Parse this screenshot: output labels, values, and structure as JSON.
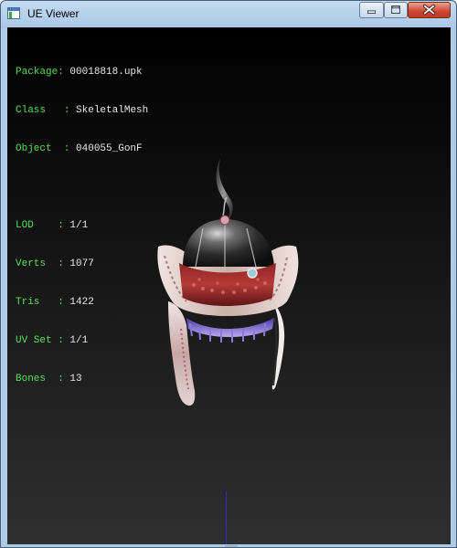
{
  "window": {
    "title": "UE Viewer",
    "colors": {
      "frame": "#aecbe6",
      "close_button": "#c9462f",
      "label_text": "#55e055",
      "value_text": "#e8e8e8",
      "axis_line": "#2a2ad8"
    }
  },
  "controls": {
    "minimize_icon": "minimize-icon",
    "maximize_icon": "maximize-icon",
    "close_icon": "close-icon"
  },
  "info": {
    "package": {
      "label": "Package",
      "value": "00018818.upk"
    },
    "class": {
      "label": "Class",
      "value": "SkeletalMesh"
    },
    "object": {
      "label": "Object",
      "value": "040055_GonF"
    },
    "lod": {
      "label": "LOD",
      "value": "1/1"
    },
    "verts": {
      "label": "Verts",
      "value": "1077"
    },
    "tris": {
      "label": "Tris",
      "value": "1422"
    },
    "uv_set": {
      "label": "UV Set",
      "value": "1/1"
    },
    "bones": {
      "label": "Bones",
      "value": "13"
    }
  }
}
